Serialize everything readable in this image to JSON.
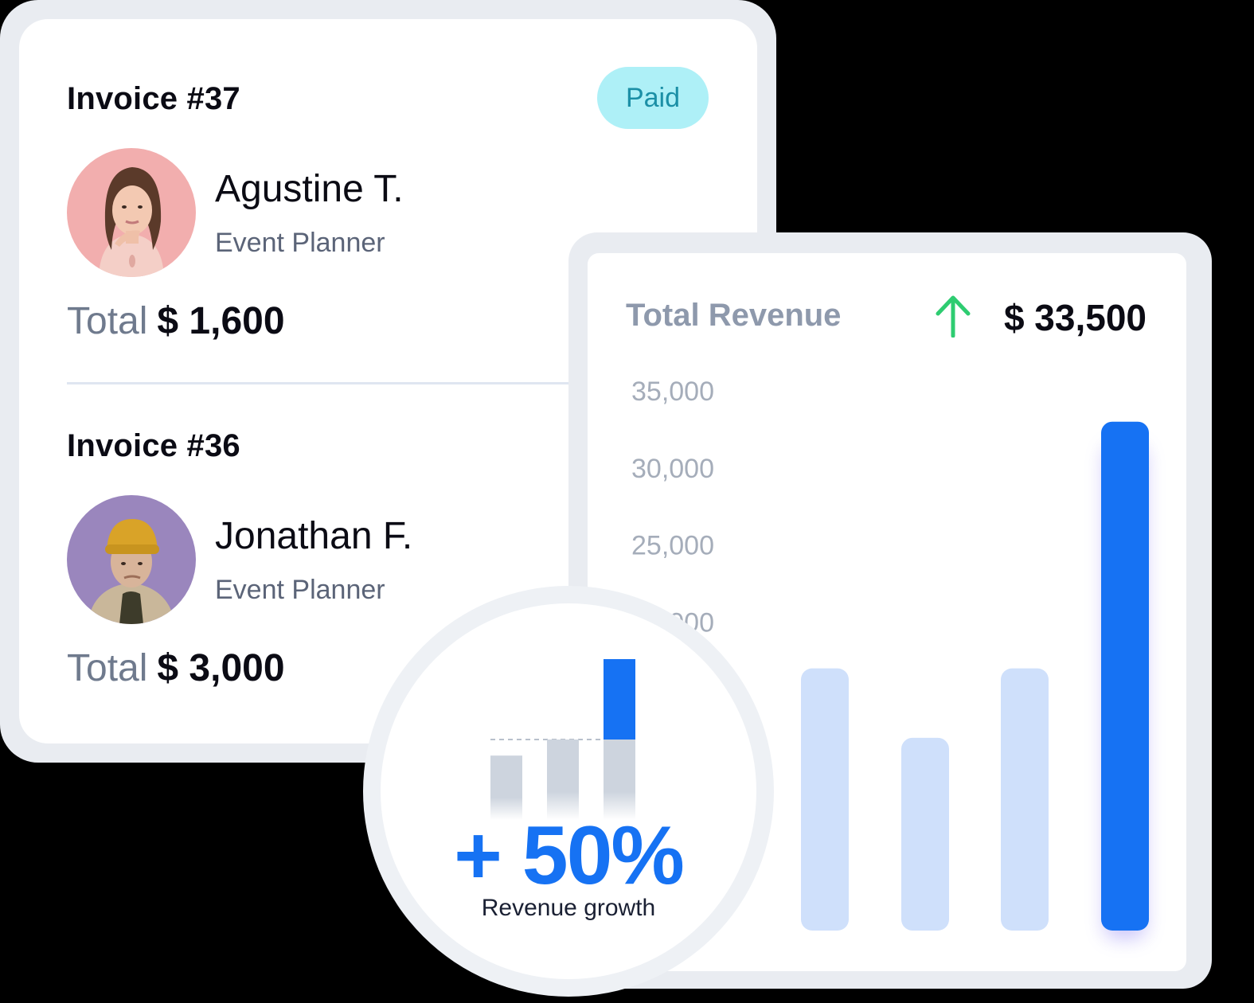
{
  "invoices": [
    {
      "title": "Invoice #37",
      "status": "Paid",
      "name": "Agustine T.",
      "role": "Event Planner",
      "total_label": "Total",
      "total_value": "$ 1,600"
    },
    {
      "title": "Invoice #36",
      "name": "Jonathan F.",
      "role": "Event Planner",
      "total_label": "Total",
      "total_value": "$ 3,000"
    }
  ],
  "revenue": {
    "title": "Total Revenue",
    "amount": "$ 33,500",
    "trend_icon": "arrow-up-icon"
  },
  "growth": {
    "value": "+ 50%",
    "label": "Revenue growth"
  },
  "colors": {
    "accent": "#1672f3",
    "bar_light": "#cfe0fb",
    "badge_bg": "#aef0f7",
    "badge_text": "#1b8fa6",
    "trend_up": "#2ecc71"
  },
  "chart_data": {
    "type": "bar",
    "ytick_labels": [
      "35,000",
      "30,000",
      "25,000",
      "20,000"
    ],
    "yticks": [
      35000,
      30000,
      25000,
      20000
    ],
    "ylim": [
      0,
      35000
    ],
    "values": [
      17000,
      12500,
      17000,
      33000
    ],
    "highlight_index": 3
  },
  "mini_chart": {
    "values": [
      40,
      50,
      50,
      100
    ],
    "highlight_from": 50
  }
}
